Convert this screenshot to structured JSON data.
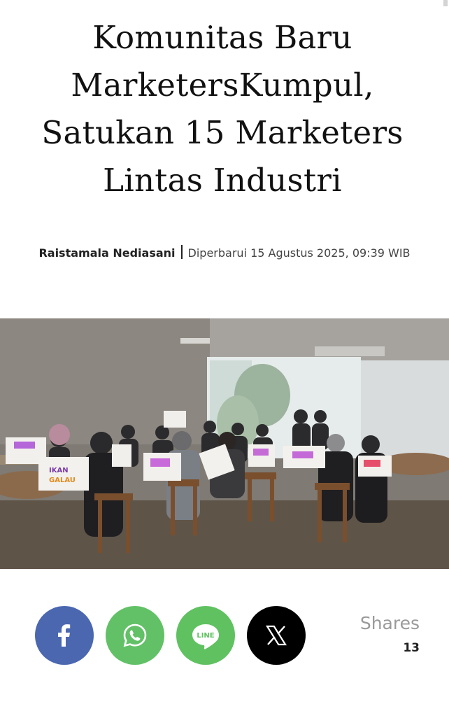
{
  "article": {
    "headline": "Komunitas Baru MarketersKumpul, Satukan 15 Marketers Lintas Industri",
    "author": "Raistamala Nediasani",
    "date": "Diperbarui 15 Agustus 2025, 09:39 WIB"
  },
  "hero_image": {
    "bag_text_1": "IKAN",
    "bag_text_2": "GALAU"
  },
  "share": {
    "buttons": [
      {
        "id": "facebook",
        "icon": "facebook-icon",
        "color": "#4a67b0"
      },
      {
        "id": "whatsapp",
        "icon": "whatsapp-icon",
        "color": "#62c166"
      },
      {
        "id": "line",
        "icon": "line-icon",
        "color": "#60c161",
        "icon_text": "LINE"
      },
      {
        "id": "x",
        "icon": "x-icon",
        "color": "#000000"
      }
    ],
    "label": "Shares",
    "count": "13"
  }
}
